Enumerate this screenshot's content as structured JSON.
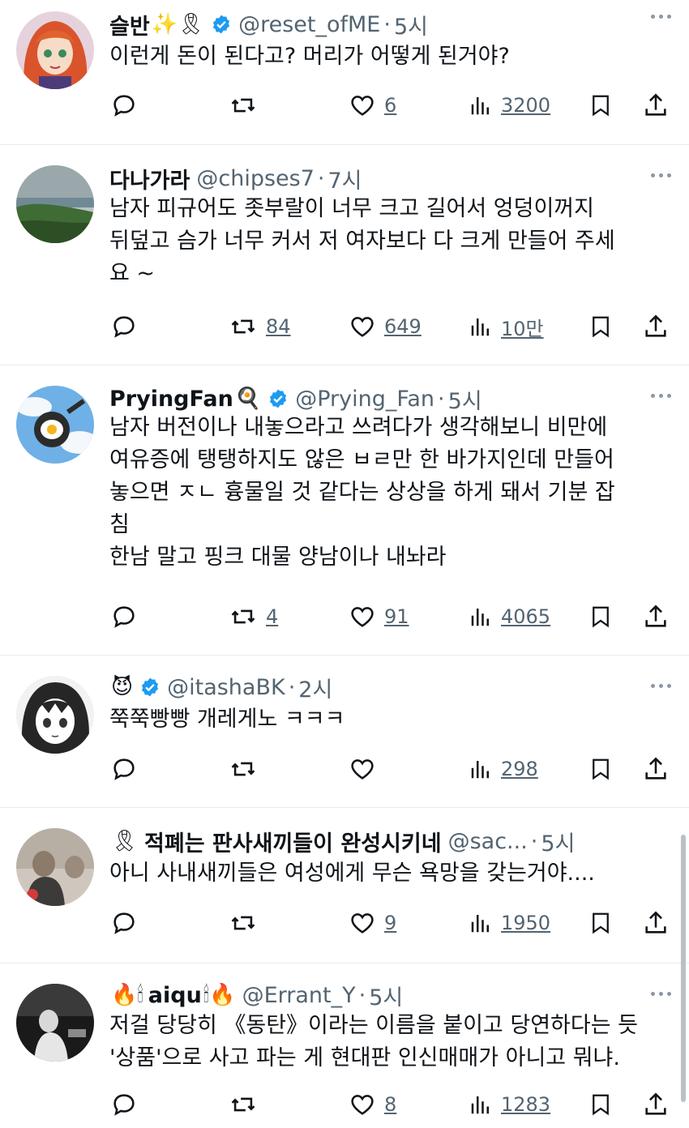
{
  "tweets": [
    {
      "name": "슬반",
      "name_emoji": "✨🎗",
      "verified": true,
      "handle": "@reset_ofME",
      "time": "5시",
      "text": "이런게 돈이 된다고? 머리가 어떻게 된거야?",
      "retweets": "",
      "likes": "6",
      "views": "3200"
    },
    {
      "name": "다나가라",
      "name_emoji": "",
      "verified": false,
      "handle": "@chipses7",
      "time": "7시",
      "text": "남자 피규어도 좃부랄이 너무 크고 길어서 엉덩이꺼지\n뒤덮고 슴가 너무 커서 저 여자보다 다 크게 만들어 주세\n요 ~",
      "retweets": "84",
      "likes": "649",
      "views": "10만"
    },
    {
      "name": "PryingFan",
      "name_emoji": "🍳",
      "verified": true,
      "handle": "@Prying_Fan",
      "time": "5시",
      "text": "남자 버전이나 내놓으라고 쓰려다가 생각해보니 비만에\n여유증에 탱탱하지도 않은 ㅂㄹ만 한 바가지인데 만들어\n놓으면 ㅈㄴ 흉물일 것 같다는 상상을 하게 돼서 기분 잡\n침\n한남 말고 핑크 대물 양남이나 내놔라",
      "retweets": "4",
      "likes": "91",
      "views": "4065"
    },
    {
      "name": "",
      "name_emoji": "😈",
      "verified": true,
      "handle": "@itashaBK",
      "time": "2시",
      "text": "쭉쭉빵빵 개레게노 ㅋㅋㅋ",
      "retweets": "",
      "likes": "",
      "views": "298"
    },
    {
      "name": "적폐는 판사새끼들이 완성시키네",
      "name_emoji": "🎗",
      "verified": false,
      "handle": "@sac...",
      "time": "5시",
      "text": "아니 사내새끼들은 여성에게 무슨 욕망을 갖는거야....",
      "retweets": "",
      "likes": "9",
      "views": "1950"
    },
    {
      "name": "aiqu",
      "name_emoji": "🔥🕯",
      "name_emoji_after": "🕯🔥",
      "verified": false,
      "handle": "@Errant_Y",
      "time": "5시",
      "text": "저걸 당당히 《동탄》이라는 이름을 붙이고 당연하다는 듯\n'상품'으로 사고 파는 게 현대판 인신매매가 아니고 뭐냐.",
      "retweets": "",
      "likes": "8",
      "views": "1283"
    }
  ],
  "colors": {
    "text": "#0f1419",
    "secondary": "#536471",
    "verified": "#1d9bf0",
    "divider": "#e8ebee"
  },
  "icons": [
    "reply-icon",
    "retweet-icon",
    "like-icon",
    "views-icon",
    "bookmark-icon",
    "share-icon",
    "verified-badge-icon",
    "more-icon"
  ]
}
